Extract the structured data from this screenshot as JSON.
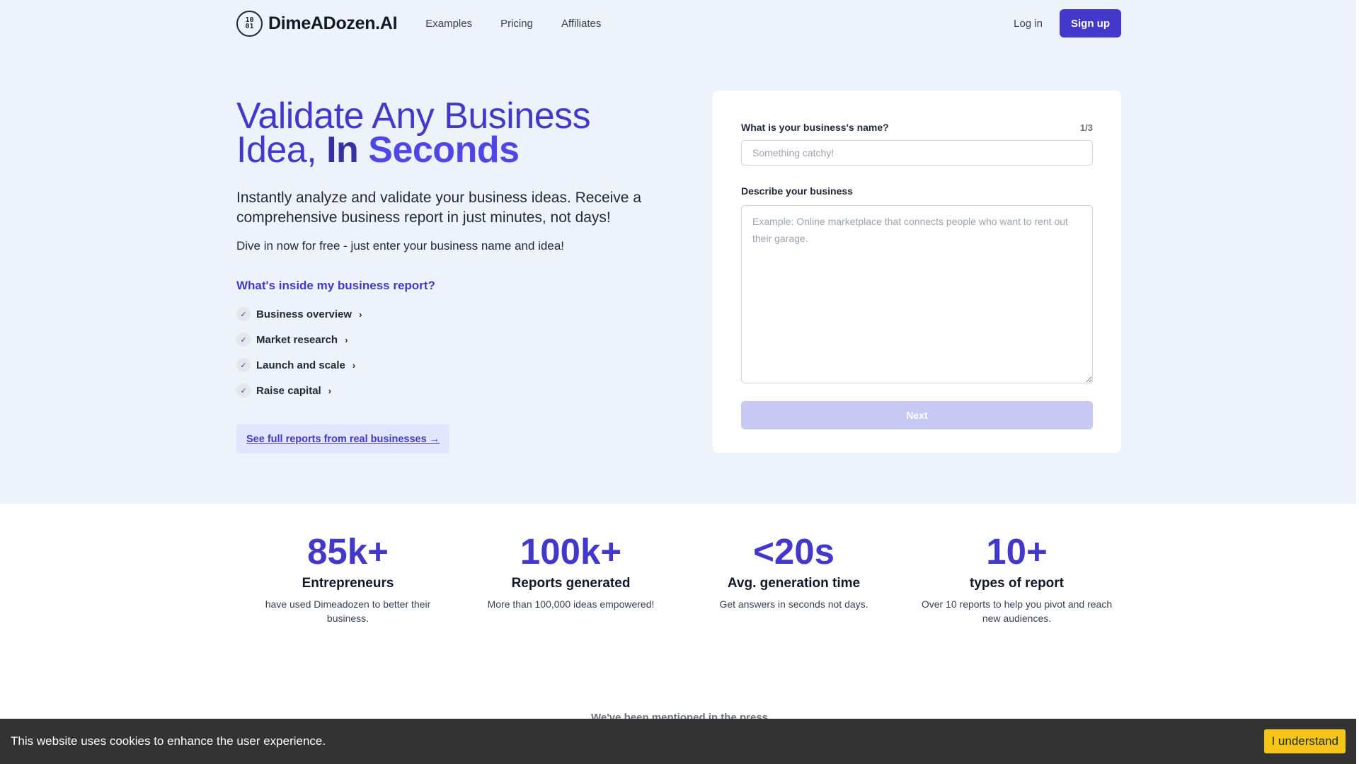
{
  "header": {
    "logo_mark": "10\n01",
    "brand": "DimeADozen.AI",
    "nav": [
      "Examples",
      "Pricing",
      "Affiliates"
    ],
    "login": "Log in",
    "signup": "Sign up"
  },
  "hero": {
    "title_part1": "Validate Any Business Idea, ",
    "title_in": "In ",
    "title_seconds": "Seconds",
    "subtitle": "Instantly analyze and validate your business ideas. Receive a comprehensive business report in just minutes, not days!",
    "note": "Dive in now for free - just enter your business name and idea!",
    "inside_title": "What's inside my business report?",
    "features": [
      "Business overview",
      "Market research",
      "Launch and scale",
      "Raise capital"
    ],
    "reports_button": "See full reports from real businesses →"
  },
  "form": {
    "name_label": "What is your business's name?",
    "step": "1/3",
    "name_placeholder": "Something catchy!",
    "name_value": "",
    "desc_label": "Describe your business",
    "desc_placeholder": "Example: Online marketplace that connects people who want to rent out their garage.",
    "desc_value": "",
    "next": "Next"
  },
  "stats": [
    {
      "num": "85k+",
      "title": "Entrepreneurs",
      "desc": "have used Dimeadozen to better their business."
    },
    {
      "num": "100k+",
      "title": "Reports generated",
      "desc": "More than 100,000 ideas empowered!"
    },
    {
      "num": "<20s",
      "title": "Avg. generation time",
      "desc": "Get answers in seconds not days."
    },
    {
      "num": "10+",
      "title": "types of report",
      "desc": "Over 10 reports to help you pivot and reach new audiences."
    }
  ],
  "press": "We've been mentioned in the press",
  "cookie": {
    "text": "This website uses cookies to enhance the user experience.",
    "button": "I understand"
  },
  "colors": {
    "accent": "#4338ca",
    "hero_bg": "#eef2fb",
    "cookie_bg": "#333333",
    "cookie_button": "#f5c518",
    "next_disabled": "#c7c9f2"
  }
}
